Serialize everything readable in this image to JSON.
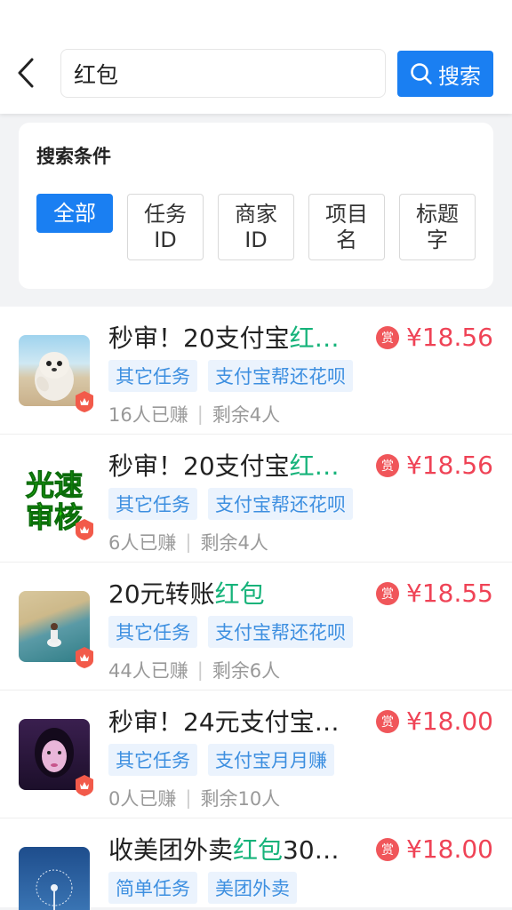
{
  "header": {
    "search_value": "红包",
    "search_button_label": "搜索"
  },
  "filter": {
    "title": "搜索条件",
    "chips": [
      "全部",
      "任务ID",
      "商家ID",
      "项目名",
      "标题字"
    ],
    "chip_lines": [
      [
        "全部"
      ],
      [
        "任务",
        "ID"
      ],
      [
        "商家",
        "ID"
      ],
      [
        "项目",
        "名"
      ],
      [
        "标题",
        "字"
      ]
    ]
  },
  "tasks": [
    {
      "title_prefix": "秒审！20支付宝",
      "title_highlight": "红",
      "title_suffix": "…",
      "tags": [
        "其它任务",
        "支付宝帮还花呗"
      ],
      "earned": "16人已赚",
      "remaining": "剩余4人",
      "reward_icon": "赏",
      "price": "¥18.56",
      "thumb": "seal-photo"
    },
    {
      "title_prefix": "秒审！20支付宝",
      "title_highlight": "红",
      "title_suffix": "…",
      "tags": [
        "其它任务",
        "支付宝帮还花呗"
      ],
      "earned": "6人已赚",
      "remaining": "剩余4人",
      "reward_icon": "赏",
      "price": "¥18.56",
      "thumb": "fast-review-logo",
      "thumb_text_1": "光速",
      "thumb_text_2": "审核"
    },
    {
      "title_prefix": "20元转账",
      "title_highlight": "红包",
      "title_suffix": "",
      "tags": [
        "其它任务",
        "支付宝帮还花呗"
      ],
      "earned": "44人已赚",
      "remaining": "剩余6人",
      "reward_icon": "赏",
      "price": "¥18.55",
      "thumb": "beach-photo"
    },
    {
      "title_prefix": "秒审！24元支付宝…",
      "title_highlight": "",
      "title_suffix": "",
      "tags": [
        "其它任务",
        "支付宝月月赚"
      ],
      "earned": "0人已赚",
      "remaining": "剩余10人",
      "reward_icon": "赏",
      "price": "¥18.00",
      "thumb": "portrait-photo"
    },
    {
      "title_prefix": "收美团外卖",
      "title_highlight": "红包",
      "title_suffix": "30…",
      "tags": [
        "简单任务",
        "美团外卖"
      ],
      "earned": "",
      "remaining": "",
      "reward_icon": "赏",
      "price": "¥18.00",
      "thumb": "dandelion-photo"
    }
  ],
  "colors": {
    "accent": "#1a7ff2",
    "price": "#ef4356",
    "highlight": "#16b37a",
    "tag_bg": "#ebf3fd",
    "tag_text": "#3d8fe0"
  }
}
